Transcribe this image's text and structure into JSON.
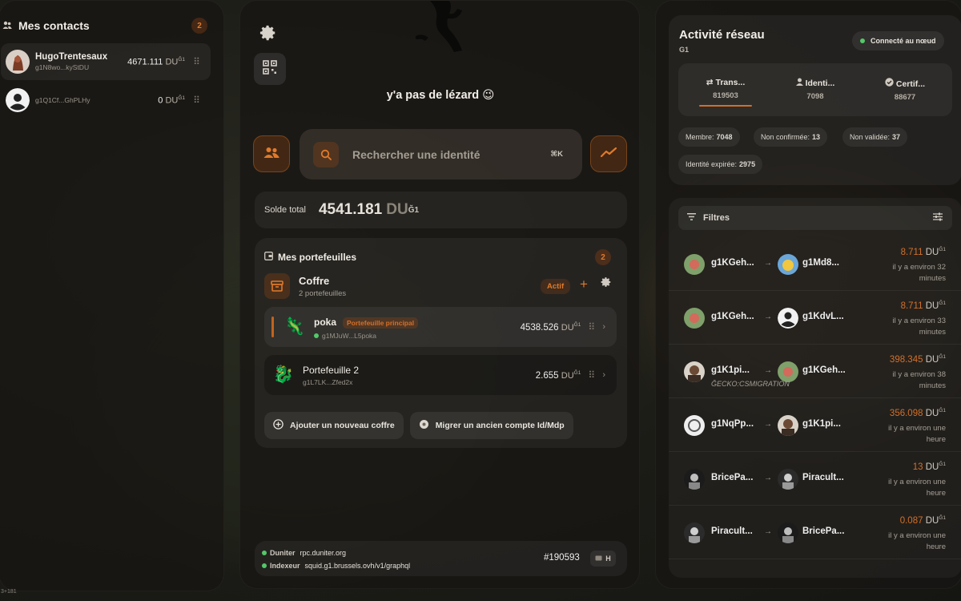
{
  "contacts": {
    "title": "Mes contacts",
    "count": "2",
    "items": [
      {
        "name": "HugoTrentesaux",
        "address": "g1N8wo...kyStDU",
        "amount": "4671.111",
        "unit": "DU",
        "sup": "Ğ1"
      },
      {
        "name": "",
        "address": "g1Q1Cf...GhPLHy",
        "amount": "0",
        "unit": "DU",
        "sup": "Ğ1"
      }
    ]
  },
  "corner_text": "3+181",
  "center": {
    "slogan": "y'a pas de lézard 😉",
    "search_placeholder": "Rechercher une identité",
    "search_shortcut": "⌘K",
    "balance_label": "Solde total",
    "balance_value": "4541.181",
    "balance_unit": "DU",
    "balance_sup": "Ğ1"
  },
  "wallets": {
    "title": "Mes portefeuilles",
    "count": "2",
    "vault": {
      "name": "Coffre",
      "sub": "2 portefeuilles",
      "status": "Actif"
    },
    "items": [
      {
        "name": "poka",
        "tag": "Portefeuille principal",
        "address": "g1MJuW...L5poka",
        "amount": "4538.526",
        "unit": "DU",
        "sup": "Ğ1",
        "emoji": "🦎"
      },
      {
        "name": "Portefeuille 2",
        "address": "g1L7LK...Zfed2x",
        "amount": "2.655",
        "unit": "DU",
        "sup": "Ğ1",
        "emoji": "🐉"
      }
    ],
    "add_vault": "Ajouter un nouveau coffre",
    "migrate": "Migrer un ancien compte Id/Mdp"
  },
  "footer": {
    "duniter_label": "Duniter",
    "duniter_value": "rpc.duniter.org",
    "indexer_label": "Indexeur",
    "indexer_value": "squid.g1.brussels.ovh/v1/graphql",
    "block": "#190593",
    "shortcut": "H"
  },
  "network": {
    "title": "Activité réseau",
    "currency": "G1",
    "status": "Connecté au nœud",
    "tabs": [
      {
        "label": "Trans...",
        "value": "819503"
      },
      {
        "label": "Identi...",
        "value": "7098"
      },
      {
        "label": "Certif...",
        "value": "88677"
      }
    ],
    "chips": [
      {
        "label": "Membre:",
        "value": "7048"
      },
      {
        "label": "Non confirmée:",
        "value": "13"
      },
      {
        "label": "Non validée:",
        "value": "37"
      },
      {
        "label": "Identité expirée:",
        "value": "2975"
      }
    ],
    "filters_label": "Filtres",
    "transactions": [
      {
        "from": "g1KGeh...",
        "to": "g1Md8...",
        "amount": "8.711",
        "unit": "DU",
        "sup": "Ğ1",
        "when": "il y a environ 32 minutes",
        "memo": ""
      },
      {
        "from": "g1KGeh...",
        "to": "g1KdvL...",
        "amount": "8.711",
        "unit": "DU",
        "sup": "Ğ1",
        "when": "il y a environ 33 minutes",
        "memo": ""
      },
      {
        "from": "g1K1pi...",
        "to": "g1KGeh...",
        "amount": "398.345",
        "unit": "DU",
        "sup": "Ğ1",
        "when": "il y a environ 38 minutes",
        "memo": "ĞECKO:CSMIGRATION"
      },
      {
        "from": "g1NqPp...",
        "to": "g1K1pi...",
        "amount": "356.098",
        "unit": "DU",
        "sup": "Ğ1",
        "when": "il y a environ une heure",
        "memo": ""
      },
      {
        "from": "BricePa...",
        "to": "Piracult...",
        "amount": "13",
        "unit": "DU",
        "sup": "Ğ1",
        "when": "il y a environ une heure",
        "memo": ""
      },
      {
        "from": "Piracult...",
        "to": "BricePa...",
        "amount": "0.087",
        "unit": "DU",
        "sup": "Ğ1",
        "when": "il y a environ une heure",
        "memo": ""
      }
    ]
  },
  "colors": {
    "accent": "#e07a2b",
    "online": "#53c86a"
  }
}
